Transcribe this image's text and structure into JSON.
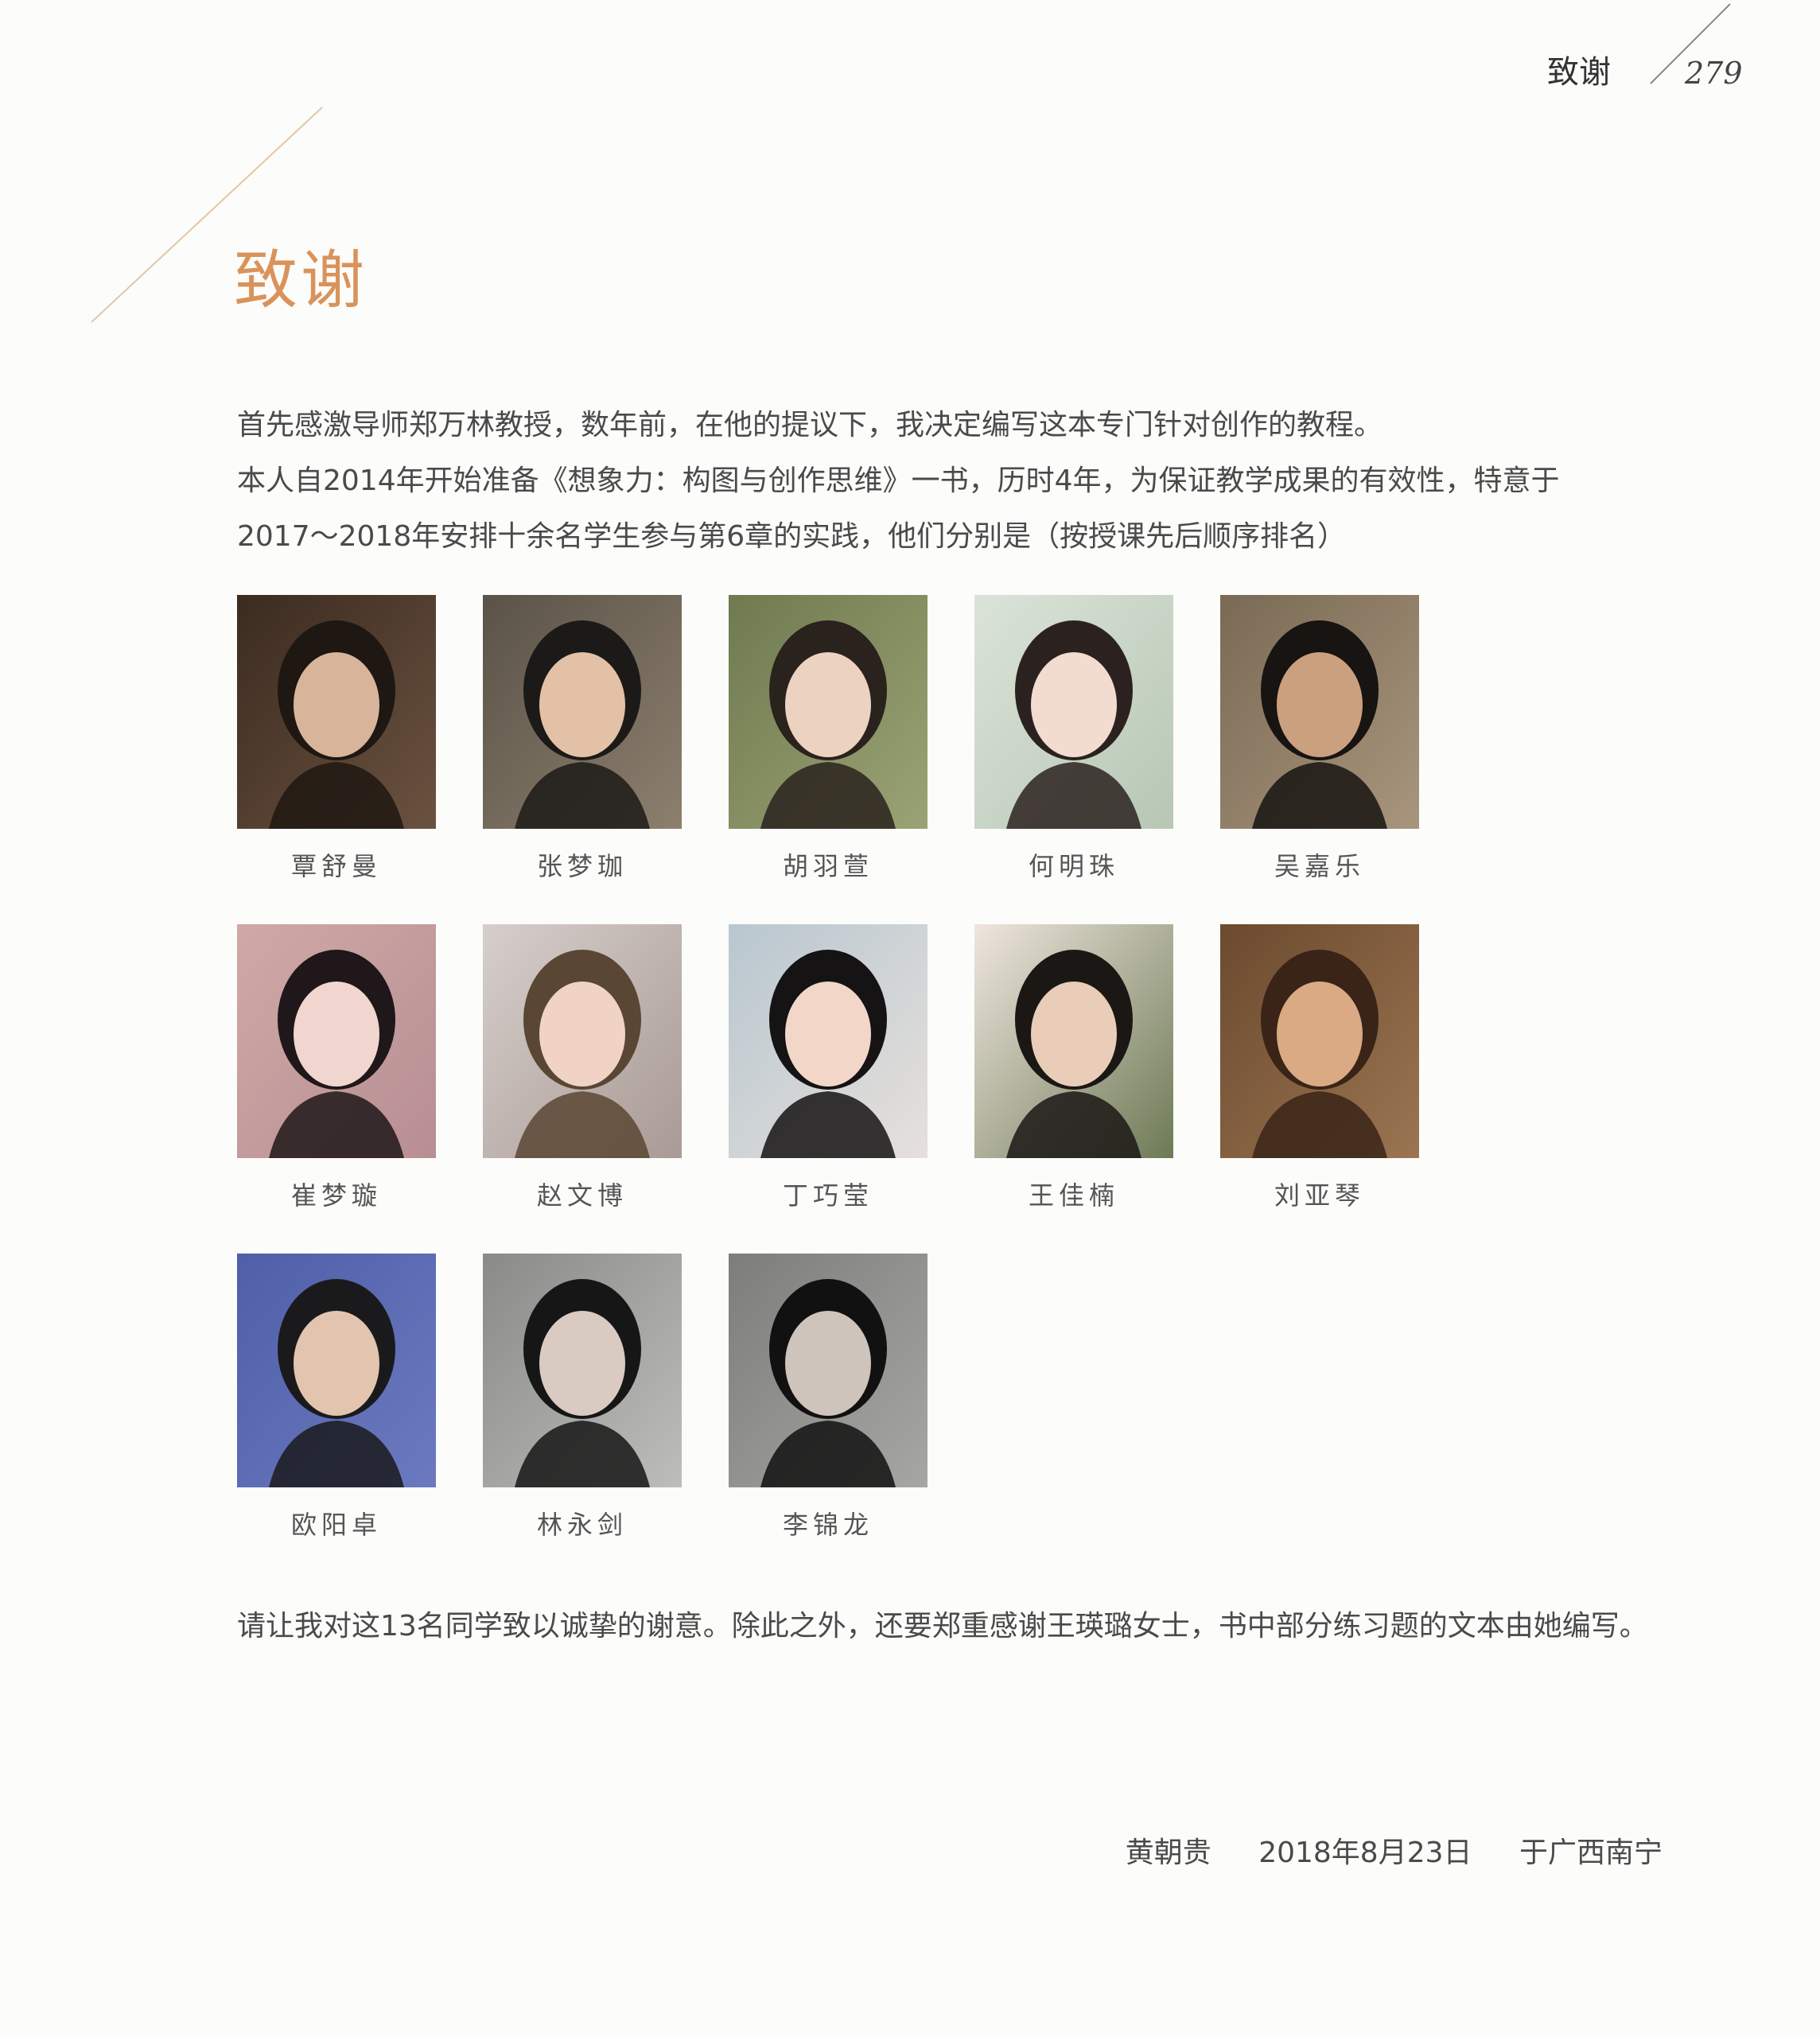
{
  "header": {
    "running_title": "致谢",
    "page_number": "279"
  },
  "title": "致谢",
  "intro": {
    "line1": "首先感激导师郑万林教授，数年前，在他的提议下，我决定编写这本专门针对创作的教程。",
    "line2": "本人自2014年开始准备《想象力：构图与创作思维》一书，历时4年，为保证教学成果的有效性，特意于",
    "line3": "2017～2018年安排十余名学生参与第6章的实践，他们分别是（按授课先后顺序排名）"
  },
  "students": [
    {
      "name": "覃舒曼"
    },
    {
      "name": "张梦珈"
    },
    {
      "name": "胡羽萱"
    },
    {
      "name": "何明珠"
    },
    {
      "name": "吴嘉乐"
    },
    {
      "name": "崔梦璇"
    },
    {
      "name": "赵文博"
    },
    {
      "name": "丁巧莹"
    },
    {
      "name": "王佳楠"
    },
    {
      "name": "刘亚琴"
    },
    {
      "name": "欧阳卓"
    },
    {
      "name": "林永剑"
    },
    {
      "name": "李锦龙"
    }
  ],
  "closing": "请让我对这13名同学致以诚挚的谢意。除此之外，还要郑重感谢王瑛璐女士，书中部分练习题的文本由她编写。",
  "signature": {
    "author": "黄朝贵",
    "date": "2018年8月23日",
    "place": "于广西南宁"
  },
  "colors": {
    "title_accent": "#d9935a",
    "body_text": "#4a4a4a"
  }
}
